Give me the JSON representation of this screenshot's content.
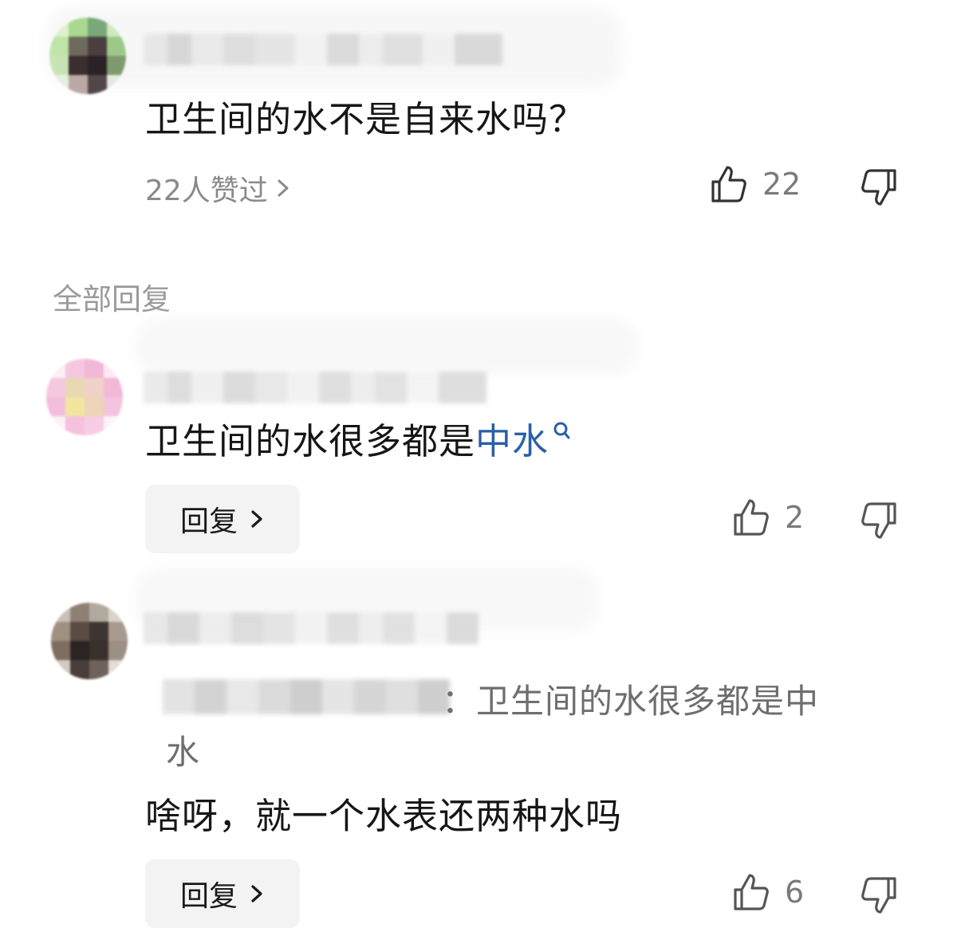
{
  "top_comment": {
    "text": "卫生间的水不是自来水吗？",
    "liked_by_summary": "22人赞过",
    "like_count": "22"
  },
  "replies_section": {
    "title": "全部回复"
  },
  "replies": [
    {
      "text_prefix": "卫生间的水很多都是",
      "keyword": "中水",
      "reply_button_label": "回复",
      "like_count": "2"
    },
    {
      "quote_line1": "：卫生间的水很多都是中",
      "quote_line2": "水",
      "text": "啥呀，就一个水表还两种水吗",
      "reply_button_label": "回复",
      "like_count": "6"
    }
  ],
  "colors": {
    "keyword": "#2b5fa8",
    "secondary_text": "#8a8a8a",
    "reply_button_bg": "#f3f3f3"
  },
  "icons": {
    "thumbs_up": "thumbs-up-icon",
    "thumbs_down": "thumbs-down-icon",
    "chevron_right": "chevron-right-icon",
    "search": "search-icon"
  }
}
